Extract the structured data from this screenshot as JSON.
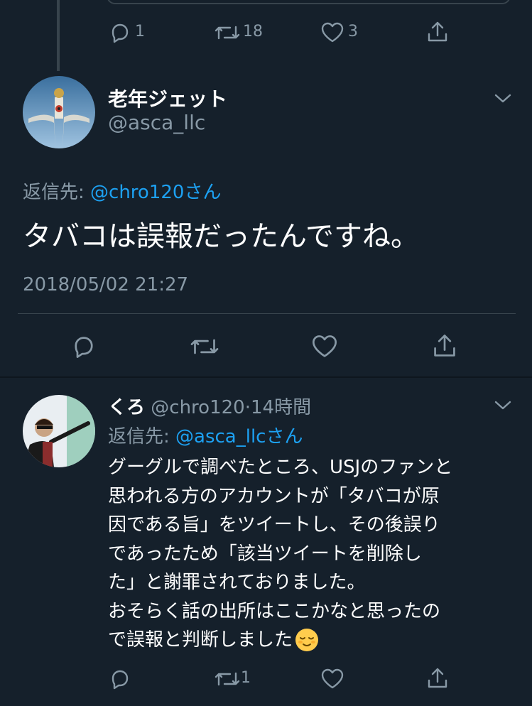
{
  "top_actions": {
    "reply_count": "1",
    "retweet_count": "18",
    "like_count": "3"
  },
  "main_tweet": {
    "name": "老年ジェット",
    "handle": "@asca_llc",
    "reply_to_prefix": "返信先: ",
    "reply_to_handle": "@chro120さん",
    "text": "タバコは誤報だったんですね。",
    "timestamp": "2018/05/02 21:27"
  },
  "reply_tweet": {
    "name": "くろ",
    "handle": "@chro120",
    "separator": "·",
    "time": "14時間",
    "reply_to_prefix": "返信先: ",
    "reply_to_handle": "@asca_llcさん",
    "lines": [
      "グーグルで調べたところ、USJのファンと",
      "思われる方のアカウントが「タバコが原",
      "因である旨」をツイートし、その後誤り",
      "であったため「該当ツイートを削除し",
      "た」と謝罪されておりました。",
      "おそらく話の出所はここかなと思ったの",
      "で誤報と判断しました"
    ],
    "emoji": "relieved-face",
    "retweet_count": "1"
  },
  "colors": {
    "background": "#15202b",
    "secondary_text": "#8899a6",
    "accent": "#1da1f2",
    "divider": "#38444d"
  }
}
